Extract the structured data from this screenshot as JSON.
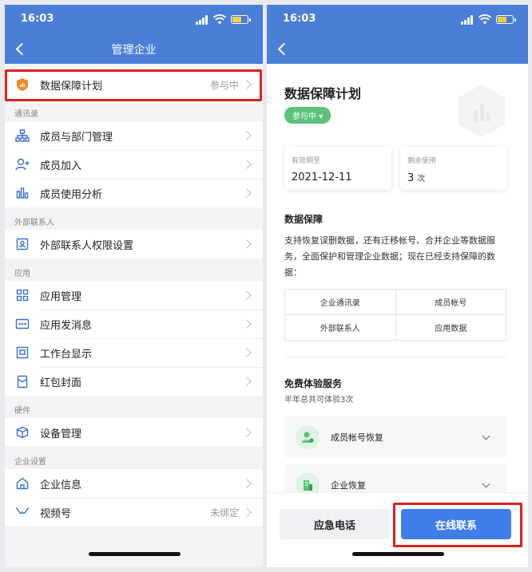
{
  "status": {
    "time": "16:03"
  },
  "left": {
    "title": "管理企业",
    "featured": {
      "label": "数据保障计划",
      "value": "参与中"
    },
    "sections": [
      {
        "header": "通讯录",
        "items": [
          {
            "label": "成员与部门管理",
            "value": ""
          },
          {
            "label": "成员加入",
            "value": ""
          },
          {
            "label": "成员使用分析",
            "value": ""
          }
        ]
      },
      {
        "header": "外部联系人",
        "items": [
          {
            "label": "外部联系人权限设置",
            "value": ""
          }
        ]
      },
      {
        "header": "应用",
        "items": [
          {
            "label": "应用管理",
            "value": ""
          },
          {
            "label": "应用发消息",
            "value": ""
          },
          {
            "label": "工作台显示",
            "value": ""
          },
          {
            "label": "红包封面",
            "value": ""
          }
        ]
      },
      {
        "header": "硬件",
        "items": [
          {
            "label": "设备管理",
            "value": ""
          }
        ]
      },
      {
        "header": "企业设置",
        "items": [
          {
            "label": "企业信息",
            "value": ""
          },
          {
            "label": "视频号",
            "value": "未绑定"
          }
        ]
      }
    ]
  },
  "right": {
    "title": "数据保障计划",
    "status_pill": "参与中",
    "cards": [
      {
        "label": "有效期至",
        "value": "2021-12-11",
        "unit": ""
      },
      {
        "label": "剩余使用",
        "value": "3",
        "unit": "次"
      }
    ],
    "protect": {
      "heading": "数据保障",
      "text": "支持恢复误删数据，还有迁移帐号、合并企业等数据服务，全面保护和管理企业数据；现在已经支持保障的数据：",
      "table": [
        [
          "企业通讯录",
          "成员帐号"
        ],
        [
          "外部联系人",
          "应用数据"
        ]
      ]
    },
    "trial": {
      "heading": "免费体验服务",
      "sub": "半年总共可体验3次",
      "services": [
        {
          "label": "成员帐号恢复"
        },
        {
          "label": "企业恢复"
        }
      ]
    },
    "buttons": {
      "secondary": "应急电话",
      "primary": "在线联系"
    }
  },
  "colors": {
    "brand": "#4a7fd8",
    "accent_green": "#5ec27a",
    "highlight_red": "#e02020",
    "primary_button": "#3f7ee8"
  }
}
